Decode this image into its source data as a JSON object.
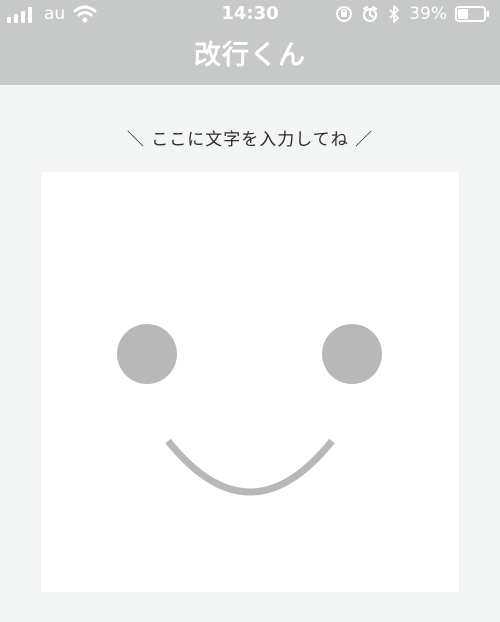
{
  "statusBar": {
    "carrier": "au",
    "time": "14:30",
    "battery_percent": "39%",
    "battery_level": 0.39,
    "icons": [
      "signal-icon",
      "wifi-icon",
      "rotation-lock-icon",
      "alarm-icon",
      "bluetooth-icon",
      "battery-icon"
    ]
  },
  "header": {
    "title": "改行くん"
  },
  "main": {
    "prompt": "＼ ここに文字を入力してね ／"
  },
  "colors": {
    "header_bg": "#c7c9c9",
    "page_bg": "#f3f4f4",
    "face_grey": "#b8b8b8",
    "card_bg": "#ffffff"
  }
}
